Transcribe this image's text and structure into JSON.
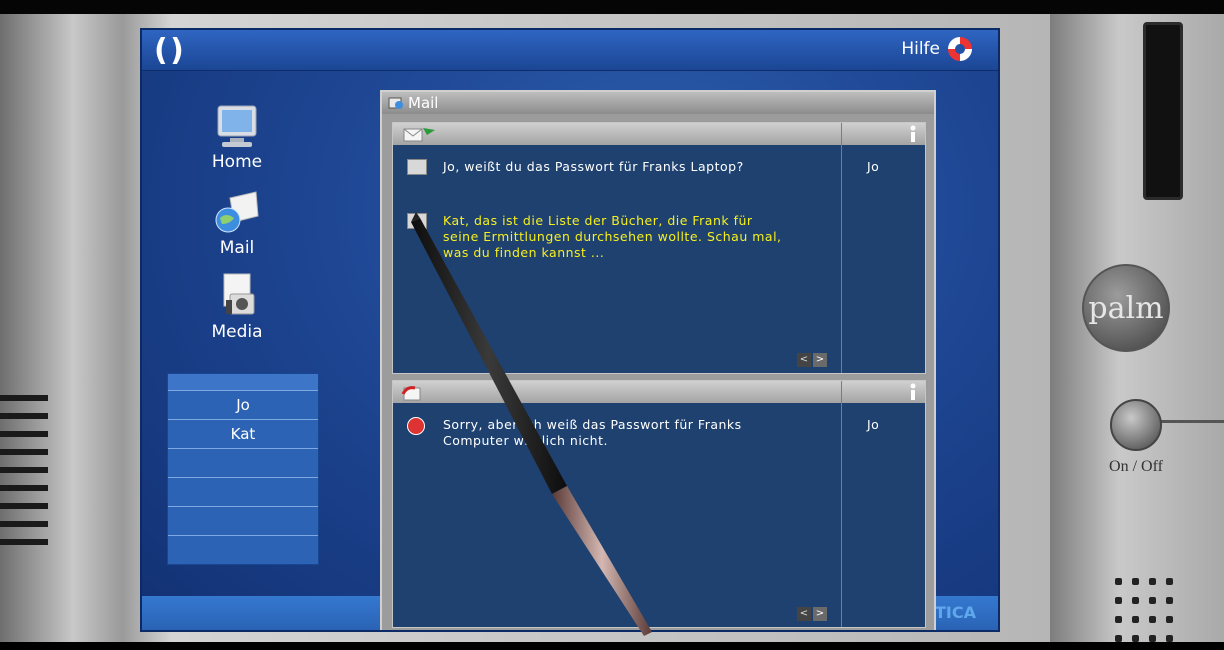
{
  "app": {
    "help_label": "Hilfe",
    "bottom_brand": "TICA"
  },
  "nav": [
    {
      "label": "Home",
      "icon": "monitor-icon"
    },
    {
      "label": "Mail",
      "icon": "mail-globe-icon"
    },
    {
      "label": "Media",
      "icon": "media-icon"
    }
  ],
  "contacts": [
    "Jo",
    "Kat",
    "",
    "",
    ""
  ],
  "mail": {
    "window_title": "Mail",
    "inbox": {
      "messages": [
        {
          "text": "Jo, weißt du das Passwort für Franks Laptop?",
          "sender": "Jo",
          "state": "read"
        },
        {
          "text": "Kat, das ist die Liste der Bücher, die Frank für seine Ermittlungen durchsehen wollte. Schau mal, was du finden kannst ...",
          "sender": "",
          "state": "unread"
        }
      ]
    },
    "outbox": {
      "messages": [
        {
          "text": "Sorry, aber ich weiß das Passwort für Franks Computer wirklich nicht.",
          "sender": "Jo"
        }
      ]
    }
  },
  "device": {
    "brand": "palm",
    "power_label": "On / Off"
  },
  "colors": {
    "screen_blue": "#1e4693",
    "pane_blue": "#1e4170",
    "unread_yellow": "#f7f01d"
  }
}
